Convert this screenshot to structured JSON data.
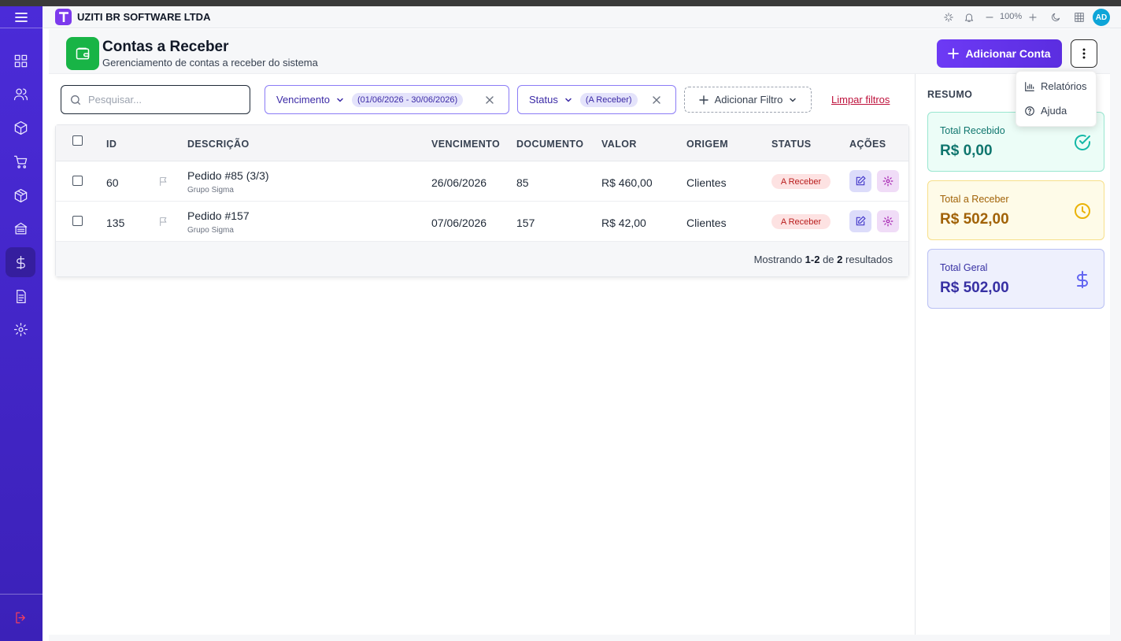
{
  "app": {
    "company": "UZITI BR SOFTWARE LTDA",
    "zoom": "100%",
    "avatar_initials": "AD"
  },
  "page": {
    "title": "Contas a Receber",
    "subtitle": "Gerenciamento de contas a receber do sistema",
    "add_button": "Adicionar Conta"
  },
  "menu": {
    "items": [
      "Relatórios",
      "Ajuda"
    ]
  },
  "filters": {
    "search_placeholder": "Pesquisar...",
    "vencimento_label": "Vencimento",
    "vencimento_value": "(01/06/2026 - 30/06/2026)",
    "status_label": "Status",
    "status_value": "(A Receber)",
    "add_filter": "Adicionar Filtro",
    "clear": "Limpar filtros"
  },
  "table": {
    "headers": [
      "ID",
      "DESCRIÇÃO",
      "VENCIMENTO",
      "DOCUMENTO",
      "VALOR",
      "ORIGEM",
      "STATUS",
      "AÇÕES"
    ],
    "rows": [
      {
        "id": "60",
        "descricao": "Pedido #85 (3/3)",
        "cliente": "Grupo Sigma",
        "vencimento": "26/06/2026",
        "documento": "85",
        "valor": "R$ 460,00",
        "origem": "Clientes",
        "status": "A Receber"
      },
      {
        "id": "135",
        "descricao": "Pedido #157",
        "cliente": "Grupo Sigma",
        "vencimento": "07/06/2026",
        "documento": "157",
        "valor": "R$ 42,00",
        "origem": "Clientes",
        "status": "A Receber"
      }
    ],
    "footer": {
      "prefix": "Mostrando",
      "from": "1",
      "dash": "-",
      "to": "2",
      "mid": "de",
      "total": "2",
      "suffix": "resultados"
    }
  },
  "summary": {
    "title": "RESUMO",
    "cards": [
      {
        "label": "Total Recebido",
        "value": "R$ 0,00",
        "color": "#0f766e"
      },
      {
        "label": "Total a Receber",
        "value": "R$ 502,00",
        "color": "#a16207"
      },
      {
        "label": "Total Geral",
        "value": "R$ 502,00",
        "color": "#3730a3"
      }
    ]
  }
}
